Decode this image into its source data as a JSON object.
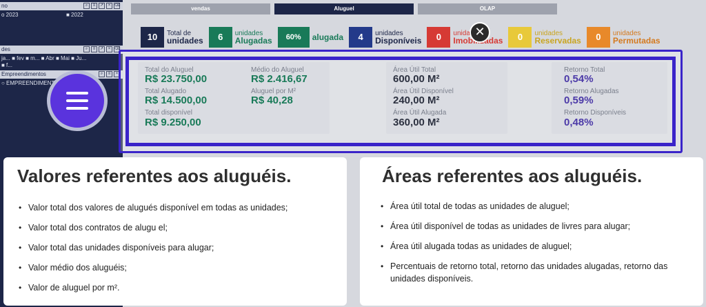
{
  "left_panel": {
    "bar1_title": "no",
    "row1_a": "o 2023",
    "row1_b": "■ 2022",
    "bar2_title": "des",
    "row2": "ja...   ■ fev   ■ m...   ■ Abr   ■ Mai   ■ Ju...",
    "row2b": "■ f...",
    "bar3_title": "Empreendimentos",
    "row3": "○ EMPREENDIMENTO"
  },
  "tabs": [
    "vendas",
    "Aluguel",
    "OLAP"
  ],
  "kpis": [
    {
      "num": "10",
      "top": "Total de",
      "bottom": "unidades",
      "color": "#1d2648"
    },
    {
      "num": "6",
      "top": "unidades",
      "bottom": "Alugadas",
      "color": "#197a58"
    },
    {
      "num": "60%",
      "top": "",
      "bottom": "alugada",
      "color": "#197a58"
    },
    {
      "num": "4",
      "top": "unidades",
      "bottom": "Disponíveis",
      "color": "#233a8a"
    },
    {
      "num": "0",
      "top": "unidades",
      "bottom": "Imobilizadas",
      "color": "#d63a34"
    },
    {
      "num": "0",
      "top": "unidades",
      "bottom": "Reservadas",
      "color": "#e8c93a"
    },
    {
      "num": "0",
      "top": "unidades",
      "bottom": "Permutadas",
      "color": "#e8892a"
    }
  ],
  "close_symbol": "✕",
  "values_card": {
    "total_aluguel_label": "Total do Aluguel",
    "total_aluguel": "R$ 23.750,00",
    "total_alugado_label": "Total Alugado",
    "total_alugado": "R$ 14.500,00",
    "total_disponivel_label": "Total disponível",
    "total_disponivel": "R$ 9.250,00",
    "medio_label": "Médio do Aluguel",
    "medio": "R$ 2.416,67",
    "por_m2_label": "Aluguel por M²",
    "por_m2": "R$ 40,28"
  },
  "areas_card": {
    "total_label": "Área Útil Total",
    "total": "600,00 M²",
    "disponivel_label": "Área Útil Disponível",
    "disponivel": "240,00 M²",
    "alugada_label": "Área Útil Alugada",
    "alugada": "360,00 M²"
  },
  "retorno_card": {
    "total_label": "Retorno Total",
    "total": "0,54%",
    "alugadas_label": "Retorno Alugadas",
    "alugadas": "0,59%",
    "disponiveis_label": "Retorno Disponíveis",
    "disponiveis": "0,48%"
  },
  "info_left": {
    "title": "Valores referentes aos aluguéis.",
    "items": [
      "Valor total dos valores de alugués disponível em todas as unidades;",
      "Valor total dos contratos de alugu el;",
      "Valor total das unidades disponíveis para alugar;",
      "Valor médio dos aluguéis;",
      "Valor de aluguel por m²."
    ]
  },
  "info_right": {
    "title": "Áreas referentes aos aluguéis.",
    "items": [
      "Área útil total de todas as unidades de aluguel;",
      "Área útil disponível de todas as unidades de livres para alugar;",
      "Área útil alugada  todas as unidades de aluguel;",
      "Percentuais de retorno total, retorno das unidades alugadas, retorno das unidades disponíveis."
    ]
  },
  "icons": {
    "menu": "hamburger-icon",
    "close": "close-icon"
  }
}
